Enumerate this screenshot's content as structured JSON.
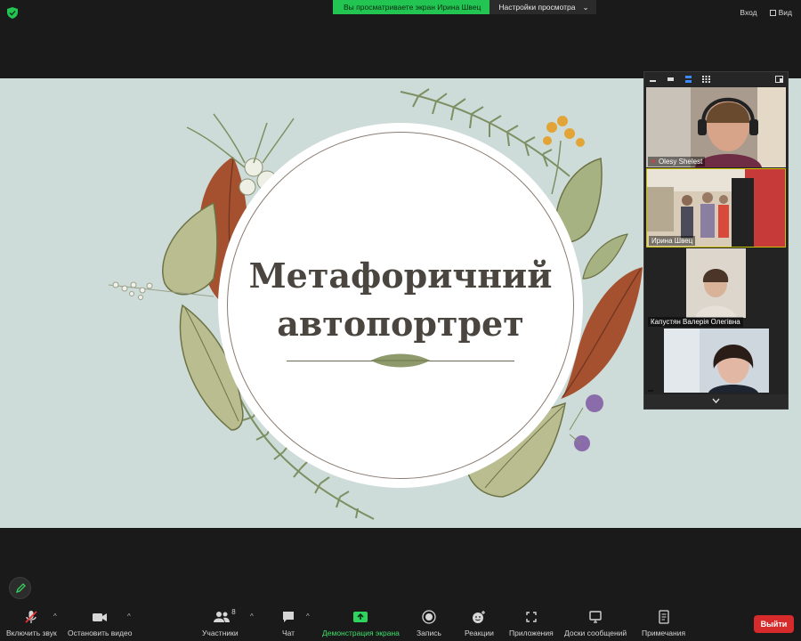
{
  "topbar": {
    "sharing_banner": "Вы просматриваете экран Ирина Швец",
    "view_options": "Настройки просмотра",
    "view_options_chevron": "⌄",
    "login": "Вход",
    "view": "Вид"
  },
  "slide": {
    "title_line1": "Метафоричний",
    "title_line2": "автопортрет"
  },
  "video_panel": {
    "participants": [
      {
        "name": "Olesy Shelest",
        "muted": true
      },
      {
        "name": "Ирина Швец",
        "muted": false
      },
      {
        "name": "Капустян Валерія Олегівна",
        "muted": false
      },
      {
        "name": "",
        "muted": false
      }
    ]
  },
  "toolbar": {
    "unmute": "Включить звук",
    "stop_video": "Остановить видео",
    "participants": "Участники",
    "participants_count": "8",
    "chat": "Чат",
    "share_screen": "Демонстрация экрана",
    "record": "Запись",
    "reactions": "Реакции",
    "apps": "Приложения",
    "whiteboards": "Доски сообщений",
    "notes": "Примечания",
    "leave": "Выйти"
  },
  "colors": {
    "share_green": "#23c552",
    "leave_red": "#d72a2a",
    "slide_bg": "#cddcd9"
  }
}
